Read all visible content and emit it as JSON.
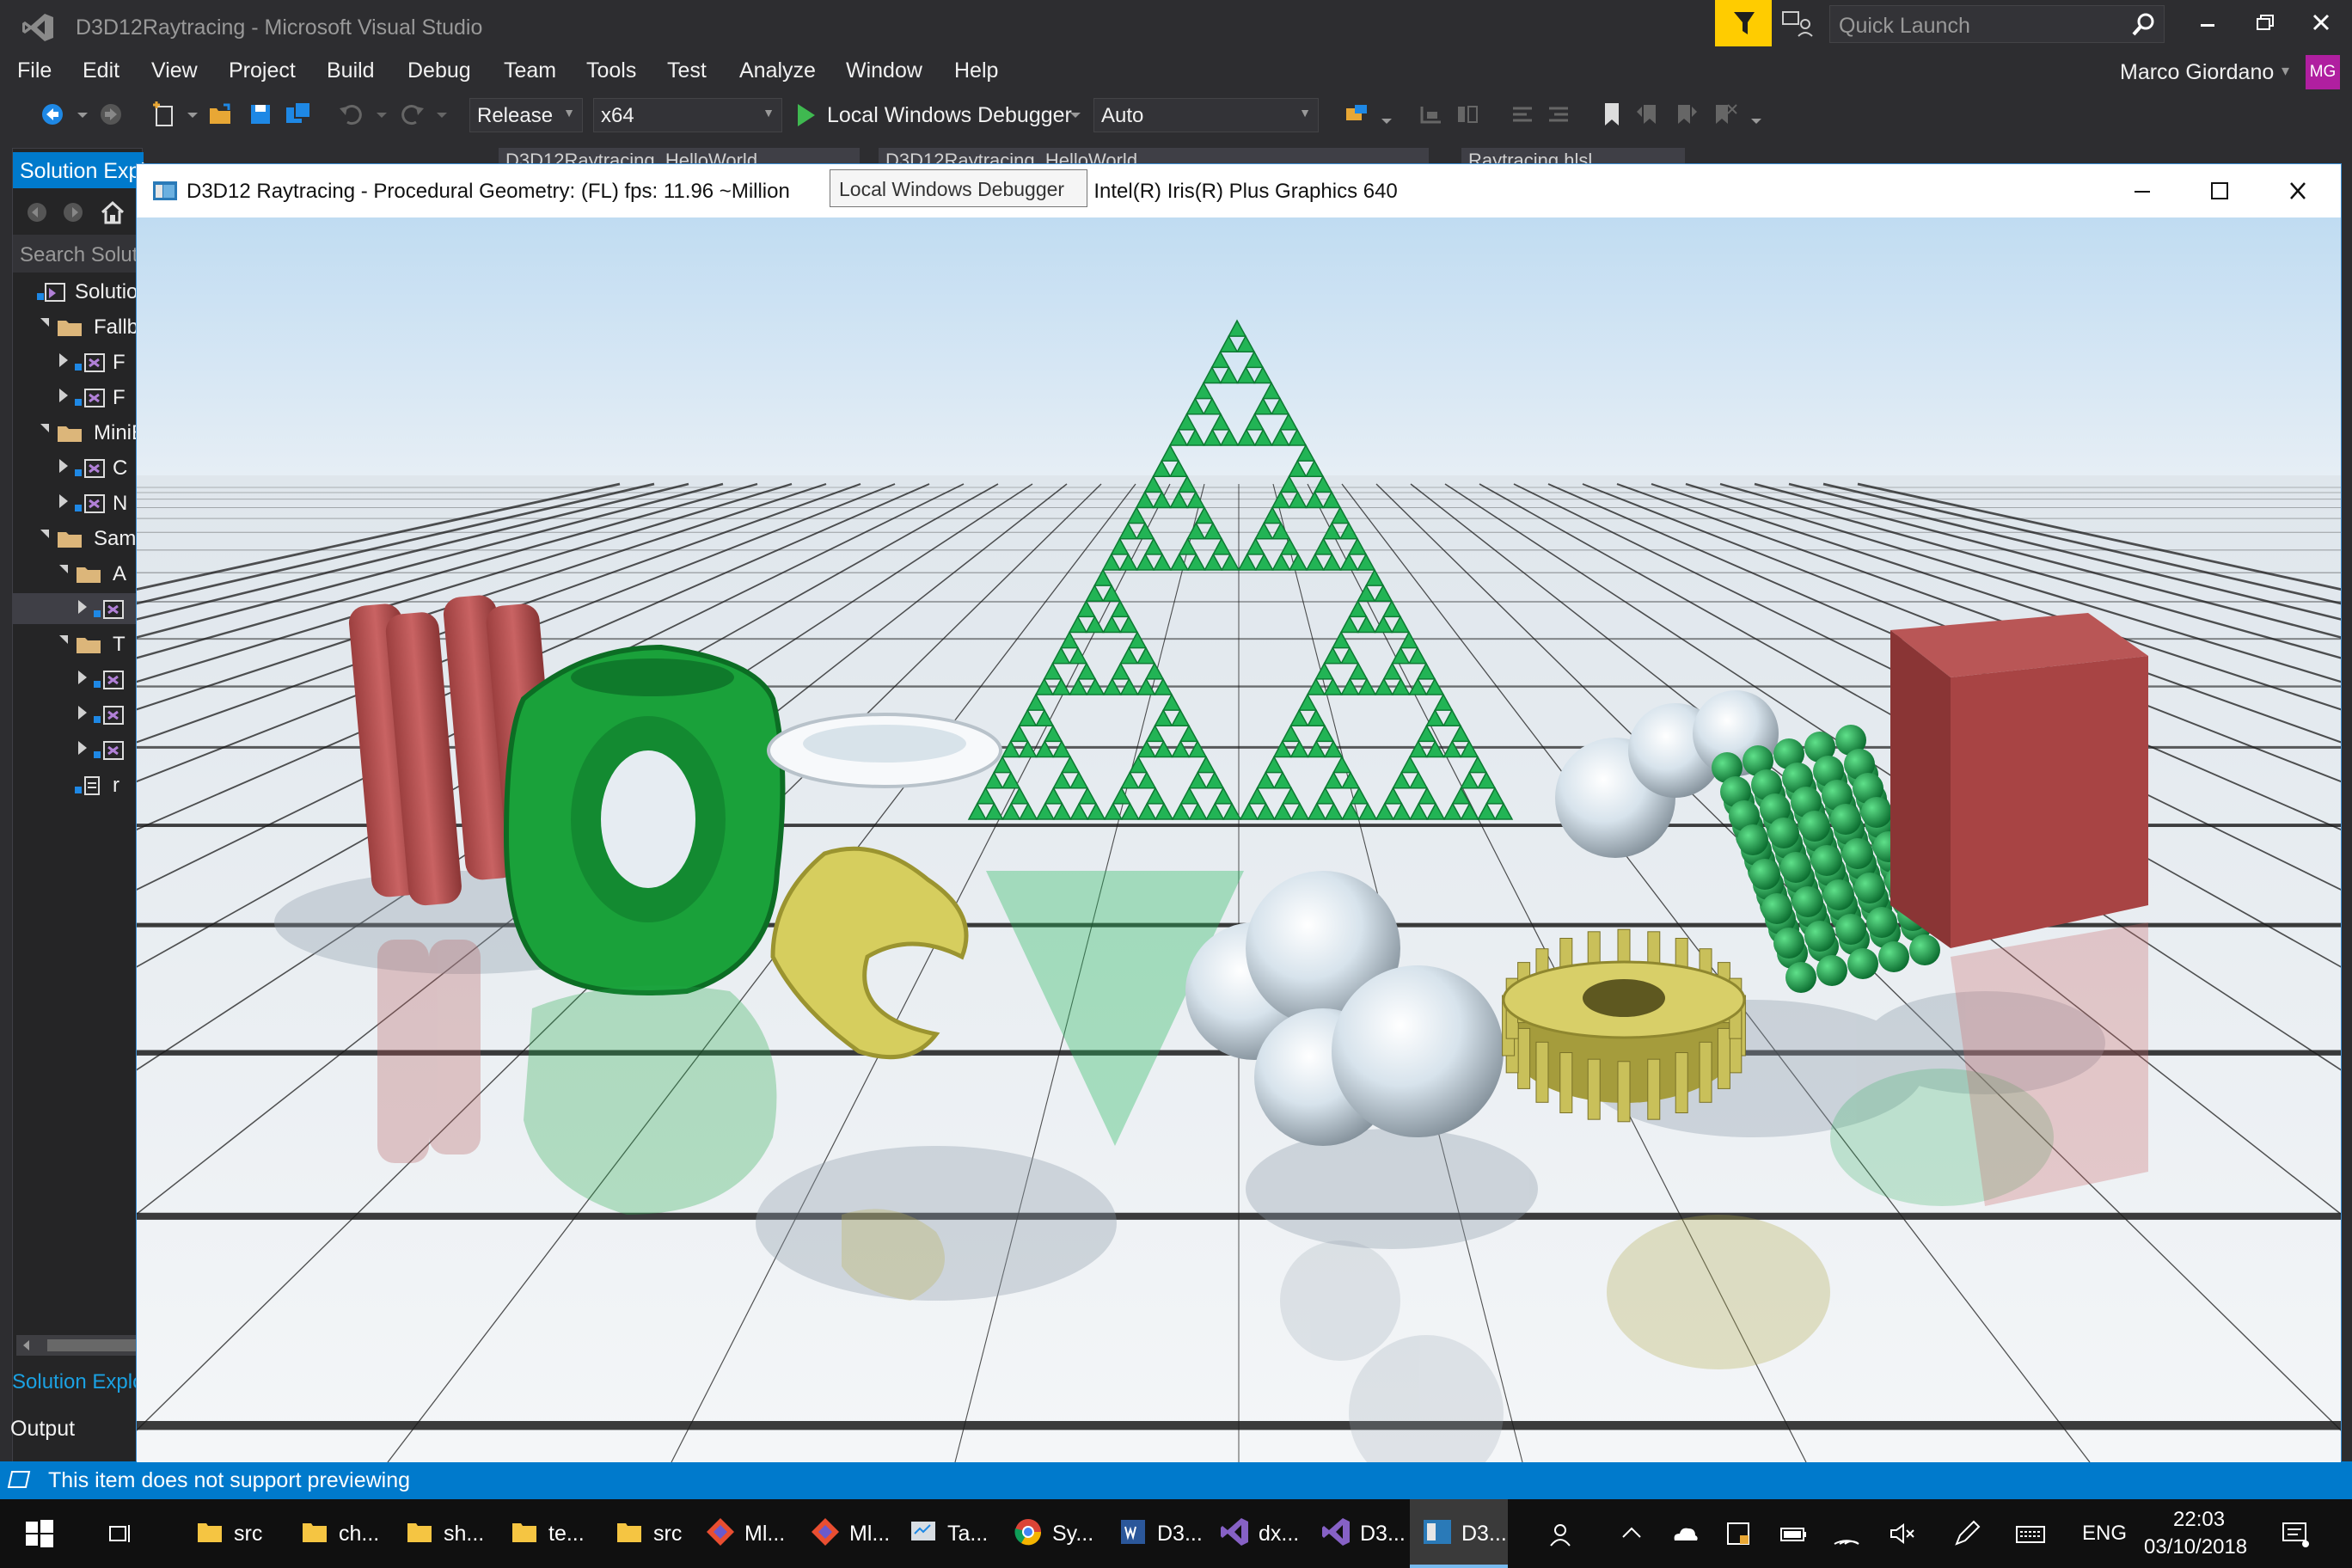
{
  "vs": {
    "title": "D3D12Raytracing - Microsoft Visual Studio",
    "quick_launch_placeholder": "Quick Launch",
    "user_name": "Marco Giordano",
    "user_initials": "MG",
    "menu": [
      "File",
      "Edit",
      "View",
      "Project",
      "Build",
      "Debug",
      "Team",
      "Tools",
      "Test",
      "Analyze",
      "Window",
      "Help"
    ],
    "config": "Release",
    "platform": "x64",
    "run_target": "Local Windows Debugger",
    "run_mode": "Auto",
    "doc_tabs": [
      "D3D12Raytracing_HelloWorld",
      "D3D12Raytracing_HelloWorld",
      "Raytracing.hlsl"
    ],
    "solution_explorer": {
      "header": "Solution Explorer",
      "search_placeholder": "Search Solution Explorer",
      "tree": [
        {
          "label": "Solution",
          "indent": 0,
          "type": "solution",
          "state": "none"
        },
        {
          "label": "Fallback",
          "indent": 1,
          "type": "folder",
          "state": "open"
        },
        {
          "label": "F",
          "indent": 2,
          "type": "project",
          "state": "closed"
        },
        {
          "label": "F",
          "indent": 2,
          "type": "project",
          "state": "closed"
        },
        {
          "label": "MiniEngine",
          "indent": 1,
          "type": "folder",
          "state": "open"
        },
        {
          "label": "C",
          "indent": 2,
          "type": "project",
          "state": "closed"
        },
        {
          "label": "N",
          "indent": 2,
          "type": "project",
          "state": "closed"
        },
        {
          "label": "Samples",
          "indent": 1,
          "type": "folder",
          "state": "open"
        },
        {
          "label": "A",
          "indent": 2,
          "type": "folder",
          "state": "open"
        },
        {
          "label": "",
          "indent": 3,
          "type": "project",
          "state": "closed",
          "selected": true
        },
        {
          "label": "T",
          "indent": 2,
          "type": "folder",
          "state": "open"
        },
        {
          "label": "",
          "indent": 3,
          "type": "project",
          "state": "closed"
        },
        {
          "label": "",
          "indent": 3,
          "type": "project",
          "state": "closed"
        },
        {
          "label": "",
          "indent": 3,
          "type": "project",
          "state": "closed"
        },
        {
          "label": "r",
          "indent": 2,
          "type": "file",
          "state": "none"
        }
      ],
      "bottom_tab": "Solution Explorer"
    },
    "output_label": "Output",
    "status_text": "This item does not support previewing"
  },
  "app": {
    "title_left": "D3D12 Raytracing - Procedural Geometry: (FL)    fps: 11.96      ~Million",
    "title_right": "0]: Intel(R) Iris(R) Plus Graphics 640",
    "tooltip": "Local Windows Debugger"
  },
  "taskbar": {
    "items": [
      {
        "label": "src",
        "icon": "folder-icon"
      },
      {
        "label": "ch...",
        "icon": "folder-icon"
      },
      {
        "label": "sh...",
        "icon": "folder-icon"
      },
      {
        "label": "te...",
        "icon": "folder-icon"
      },
      {
        "label": "src",
        "icon": "folder-icon"
      },
      {
        "label": "Ml...",
        "icon": "git-icon"
      },
      {
        "label": "Ml...",
        "icon": "git-icon"
      },
      {
        "label": "Ta...",
        "icon": "task-manager-icon"
      },
      {
        "label": "Sy...",
        "icon": "chrome-icon"
      },
      {
        "label": "D3...",
        "icon": "word-icon"
      },
      {
        "label": "dx...",
        "icon": "vs-icon"
      },
      {
        "label": "D3...",
        "icon": "vs-icon"
      },
      {
        "label": "D3...",
        "icon": "app-window-icon",
        "active": true
      }
    ],
    "lang": "ENG",
    "time": "22:03",
    "date": "03/10/2018"
  },
  "colors": {
    "vs_bg": "#2d2d30",
    "accent": "#007acc",
    "notif_yellow": "#ffcc00",
    "avatar": "#b01fa0"
  }
}
